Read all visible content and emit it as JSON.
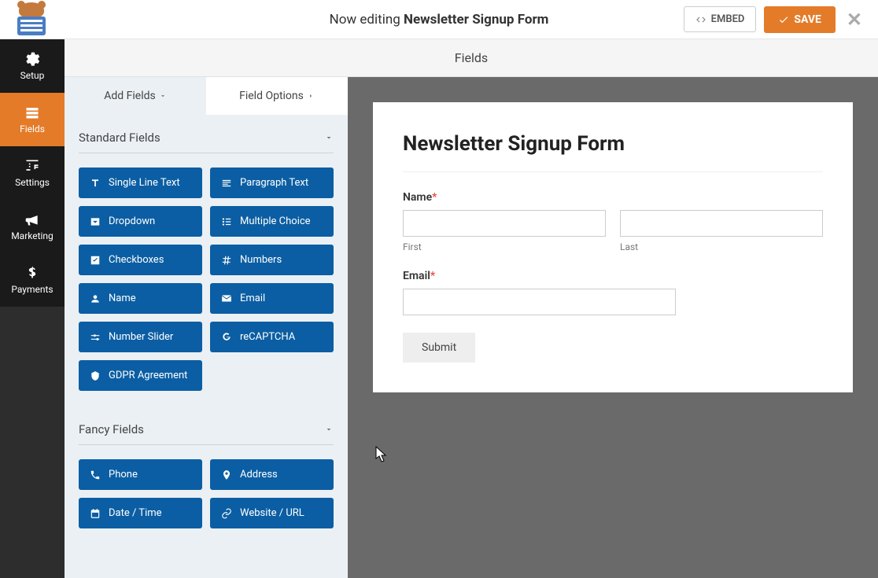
{
  "header": {
    "editing_prefix": "Now editing ",
    "form_name": "Newsletter Signup Form",
    "embed_label": "EMBED",
    "save_label": "SAVE"
  },
  "nav": {
    "setup": "Setup",
    "fields": "Fields",
    "settings": "Settings",
    "marketing": "Marketing",
    "payments": "Payments"
  },
  "section_title": "Fields",
  "panel_tabs": {
    "add_fields": "Add Fields",
    "field_options": "Field Options"
  },
  "groups": {
    "standard": {
      "title": "Standard Fields",
      "items": {
        "single_line": "Single Line Text",
        "paragraph": "Paragraph Text",
        "dropdown": "Dropdown",
        "multiple_choice": "Multiple Choice",
        "checkboxes": "Checkboxes",
        "numbers": "Numbers",
        "name": "Name",
        "email": "Email",
        "number_slider": "Number Slider",
        "recaptcha": "reCAPTCHA",
        "gdpr": "GDPR Agreement"
      }
    },
    "fancy": {
      "title": "Fancy Fields",
      "items": {
        "phone": "Phone",
        "address": "Address",
        "datetime": "Date / Time",
        "website": "Website / URL"
      }
    }
  },
  "preview": {
    "title": "Newsletter Signup Form",
    "name_label": "Name",
    "first_sub": "First",
    "last_sub": "Last",
    "email_label": "Email",
    "submit_label": "Submit"
  }
}
